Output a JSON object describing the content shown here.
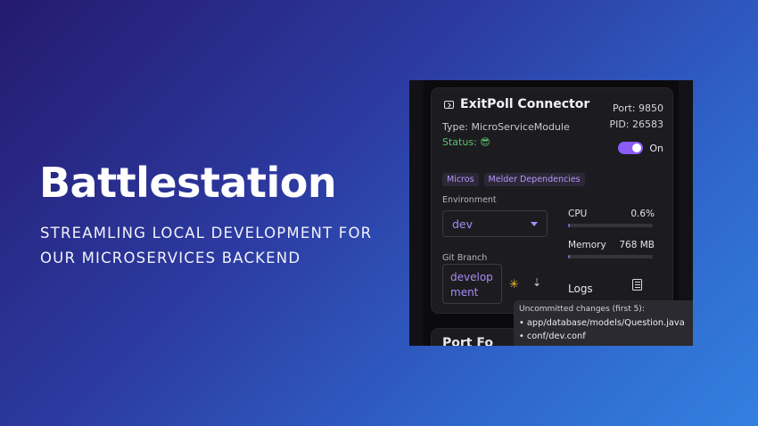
{
  "hero": {
    "title": "Battlestation",
    "subtitle": "STREAMLING LOCAL DEVELOPMENT FOR OUR MICROSERVICES BACKEND"
  },
  "service": {
    "name": "ExitPoll Connector",
    "icon": "terminal-icon",
    "port": "Port: 9850",
    "pid": "PID: 26583",
    "type": "Type: MicroServiceModule",
    "status": "Status: 😎",
    "toggle_label": "On",
    "toggle_on": true,
    "tags": [
      "Micros",
      "Melder Dependencies"
    ],
    "environment_label": "Environment",
    "environment_value": "dev",
    "git_branch_label": "Git Branch",
    "git_branch_value": "development",
    "cpu_label": "CPU",
    "cpu_value": "0.6%",
    "cpu_fraction": 0.006,
    "memory_label": "Memory",
    "memory_value": "768 MB",
    "memory_fraction": 0.02,
    "logs_label": "Logs"
  },
  "tooltip": {
    "title": "Uncommitted changes (first 5):",
    "items": [
      "• app/database/models/Question.java",
      "• conf/dev.conf"
    ]
  },
  "next_card_title": "Port Fo",
  "colors": {
    "accent": "#8b5cf6",
    "accent_text": "#a88cf5",
    "status_green": "#5cc26a",
    "sync_yellow": "#f5b731"
  }
}
